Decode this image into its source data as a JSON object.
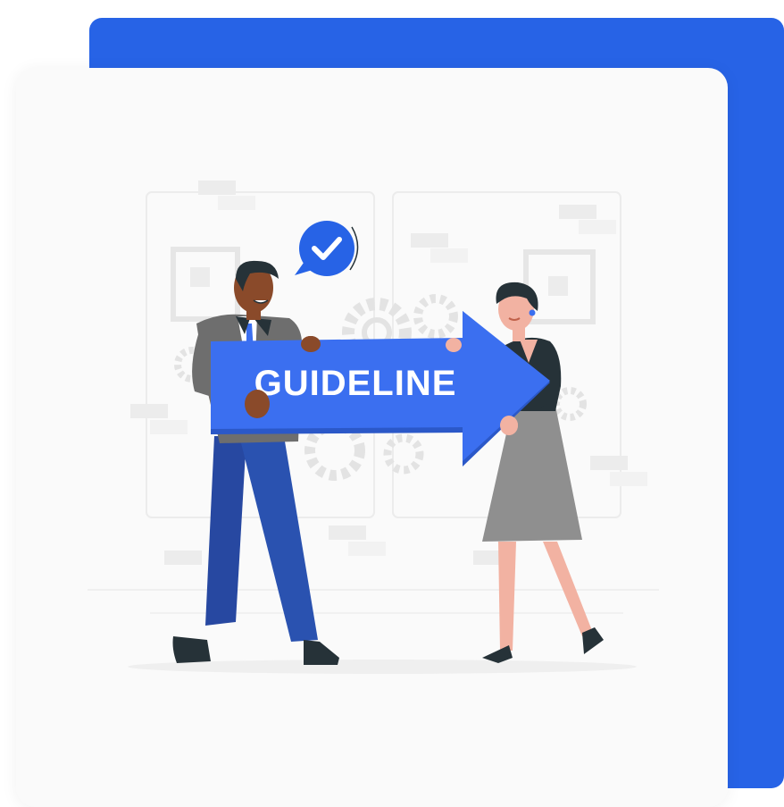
{
  "banner": {
    "sign_text": "GUIDELINE",
    "accent_color": "#2763e6",
    "arrow_color": "#3b6ff0",
    "icon": "check-bubble-icon"
  }
}
